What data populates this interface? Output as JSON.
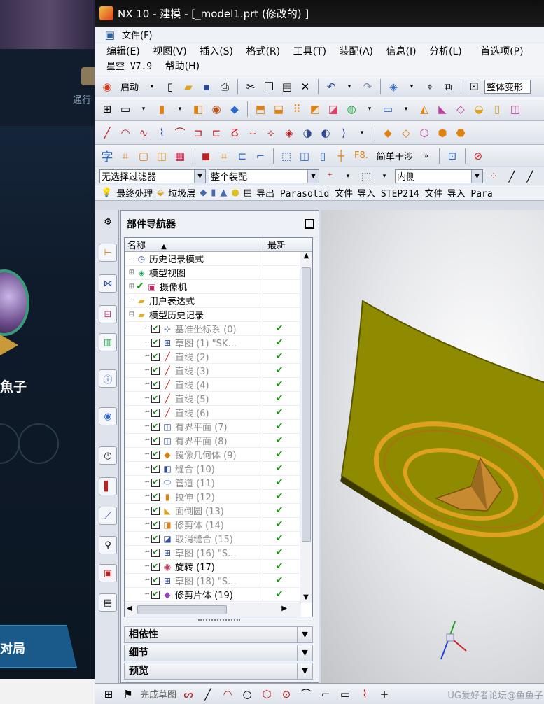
{
  "background_app": {
    "nav_label": "通行",
    "player_name": "魚子",
    "action_button": "对局"
  },
  "window": {
    "title": "NX 10 - 建模 - [_model1.prt  (修改的) ]"
  },
  "menu": {
    "file": "文件(F)",
    "items": [
      "编辑(E)",
      "视图(V)",
      "插入(S)",
      "格式(R)",
      "工具(T)",
      "装配(A)",
      "信息(I)",
      "分析(L)",
      "首选项(P)"
    ],
    "row2": [
      "星空 V7.9",
      "帮助(H)"
    ]
  },
  "toolbar": {
    "start": "启动",
    "transform": "整体变形",
    "font_char": "字",
    "f8": "F8.",
    "interference": "简单干涉"
  },
  "filters": {
    "filter": "无选择过滤器",
    "assembly": "整个装配",
    "inside": "内侧"
  },
  "quickbar": {
    "items": [
      "最终处理",
      "垃圾层",
      "导出 Parasolid 文件",
      "导入 STEP214 文件",
      "导入 Para"
    ]
  },
  "navigator": {
    "title": "部件导航器",
    "col_name": "名称",
    "col_latest": "最新",
    "rows": [
      {
        "label": "历史记录模式",
        "check": false,
        "latest": "",
        "grey": false,
        "expand": "",
        "icon": "clock"
      },
      {
        "label": "模型视图",
        "check": false,
        "latest": "",
        "grey": false,
        "expand": "+",
        "icon": "cube"
      },
      {
        "label": "摄像机",
        "check": true,
        "latest": "",
        "grey": false,
        "expand": "+",
        "icon": "camera"
      },
      {
        "label": "用户表达式",
        "check": false,
        "latest": "",
        "grey": false,
        "expand": "",
        "icon": "folder"
      },
      {
        "label": "模型历史记录",
        "check": false,
        "latest": "",
        "grey": false,
        "expand": "-",
        "icon": "folder"
      },
      {
        "label": "基准坐标系 (0)",
        "check": true,
        "latest": "✔",
        "grey": true,
        "expand": "",
        "icon": "csys"
      },
      {
        "label": "草图 (1) \"SK...",
        "check": true,
        "latest": "✔",
        "grey": true,
        "expand": "",
        "icon": "sketch"
      },
      {
        "label": "直线 (2)",
        "check": true,
        "latest": "✔",
        "grey": true,
        "expand": "",
        "icon": "line"
      },
      {
        "label": "直线 (3)",
        "check": true,
        "latest": "✔",
        "grey": true,
        "expand": "",
        "icon": "line"
      },
      {
        "label": "直线 (4)",
        "check": true,
        "latest": "✔",
        "grey": true,
        "expand": "",
        "icon": "line"
      },
      {
        "label": "直线 (5)",
        "check": true,
        "latest": "✔",
        "grey": true,
        "expand": "",
        "icon": "line"
      },
      {
        "label": "直线 (6)",
        "check": true,
        "latest": "✔",
        "grey": true,
        "expand": "",
        "icon": "line"
      },
      {
        "label": "有界平面 (7)",
        "check": true,
        "latest": "✔",
        "grey": true,
        "expand": "",
        "icon": "plane"
      },
      {
        "label": "有界平面 (8)",
        "check": true,
        "latest": "✔",
        "grey": true,
        "expand": "",
        "icon": "plane"
      },
      {
        "label": "镜像几何体 (9)",
        "check": true,
        "latest": "✔",
        "grey": true,
        "expand": "",
        "icon": "mirror"
      },
      {
        "label": "缝合 (10)",
        "check": true,
        "latest": "✔",
        "grey": true,
        "expand": "",
        "icon": "sew"
      },
      {
        "label": "管道 (11)",
        "check": true,
        "latest": "✔",
        "grey": true,
        "expand": "",
        "icon": "tube"
      },
      {
        "label": "拉伸 (12)",
        "check": true,
        "latest": "✔",
        "grey": true,
        "expand": "",
        "icon": "extrude"
      },
      {
        "label": "面倒圆 (13)",
        "check": true,
        "latest": "✔",
        "grey": true,
        "expand": "",
        "icon": "blend"
      },
      {
        "label": "修剪体 (14)",
        "check": true,
        "latest": "✔",
        "grey": true,
        "expand": "",
        "icon": "trim"
      },
      {
        "label": "取消缝合 (15)",
        "check": true,
        "latest": "✔",
        "grey": true,
        "expand": "",
        "icon": "unsew"
      },
      {
        "label": "草图 (16) \"S...",
        "check": true,
        "latest": "✔",
        "grey": true,
        "expand": "",
        "icon": "sketch"
      },
      {
        "label": "旋转 (17)",
        "check": true,
        "latest": "✔",
        "grey": false,
        "expand": "",
        "icon": "revolve"
      },
      {
        "label": "草图 (18) \"S...",
        "check": true,
        "latest": "✔",
        "grey": true,
        "expand": "",
        "icon": "sketch"
      },
      {
        "label": "修剪片体 (19)",
        "check": true,
        "latest": "✔",
        "grey": false,
        "expand": "",
        "icon": "trimsheet"
      }
    ],
    "sections": [
      "相依性",
      "细节",
      "预览"
    ]
  },
  "bottombar": {
    "finish_sketch": "完成草图",
    "watermark": "UG爱好者论坛@鱼鱼子"
  },
  "colors": {
    "surface": "#8f8b00",
    "ring": "#e0a020",
    "check": "#1a9a1a"
  }
}
